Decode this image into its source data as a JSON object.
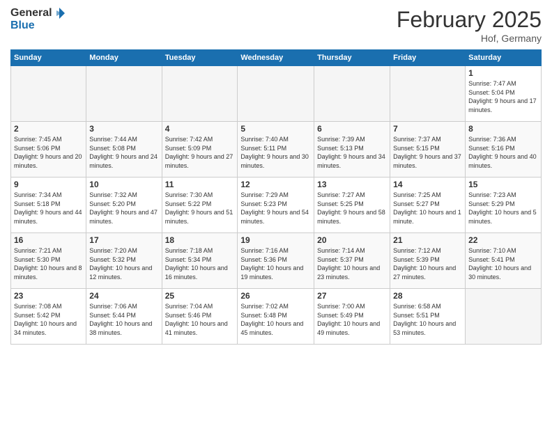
{
  "header": {
    "logo_general": "General",
    "logo_blue": "Blue",
    "month_year": "February 2025",
    "location": "Hof, Germany"
  },
  "weekdays": [
    "Sunday",
    "Monday",
    "Tuesday",
    "Wednesday",
    "Thursday",
    "Friday",
    "Saturday"
  ],
  "weeks": [
    [
      {
        "day": "",
        "empty": true
      },
      {
        "day": "",
        "empty": true
      },
      {
        "day": "",
        "empty": true
      },
      {
        "day": "",
        "empty": true
      },
      {
        "day": "",
        "empty": true
      },
      {
        "day": "",
        "empty": true
      },
      {
        "day": "1",
        "detail": "Sunrise: 7:47 AM\nSunset: 5:04 PM\nDaylight: 9 hours and 17 minutes."
      }
    ],
    [
      {
        "day": "2",
        "detail": "Sunrise: 7:45 AM\nSunset: 5:06 PM\nDaylight: 9 hours and 20 minutes."
      },
      {
        "day": "3",
        "detail": "Sunrise: 7:44 AM\nSunset: 5:08 PM\nDaylight: 9 hours and 24 minutes."
      },
      {
        "day": "4",
        "detail": "Sunrise: 7:42 AM\nSunset: 5:09 PM\nDaylight: 9 hours and 27 minutes."
      },
      {
        "day": "5",
        "detail": "Sunrise: 7:40 AM\nSunset: 5:11 PM\nDaylight: 9 hours and 30 minutes."
      },
      {
        "day": "6",
        "detail": "Sunrise: 7:39 AM\nSunset: 5:13 PM\nDaylight: 9 hours and 34 minutes."
      },
      {
        "day": "7",
        "detail": "Sunrise: 7:37 AM\nSunset: 5:15 PM\nDaylight: 9 hours and 37 minutes."
      },
      {
        "day": "8",
        "detail": "Sunrise: 7:36 AM\nSunset: 5:16 PM\nDaylight: 9 hours and 40 minutes."
      }
    ],
    [
      {
        "day": "9",
        "detail": "Sunrise: 7:34 AM\nSunset: 5:18 PM\nDaylight: 9 hours and 44 minutes."
      },
      {
        "day": "10",
        "detail": "Sunrise: 7:32 AM\nSunset: 5:20 PM\nDaylight: 9 hours and 47 minutes."
      },
      {
        "day": "11",
        "detail": "Sunrise: 7:30 AM\nSunset: 5:22 PM\nDaylight: 9 hours and 51 minutes."
      },
      {
        "day": "12",
        "detail": "Sunrise: 7:29 AM\nSunset: 5:23 PM\nDaylight: 9 hours and 54 minutes."
      },
      {
        "day": "13",
        "detail": "Sunrise: 7:27 AM\nSunset: 5:25 PM\nDaylight: 9 hours and 58 minutes."
      },
      {
        "day": "14",
        "detail": "Sunrise: 7:25 AM\nSunset: 5:27 PM\nDaylight: 10 hours and 1 minute."
      },
      {
        "day": "15",
        "detail": "Sunrise: 7:23 AM\nSunset: 5:29 PM\nDaylight: 10 hours and 5 minutes."
      }
    ],
    [
      {
        "day": "16",
        "detail": "Sunrise: 7:21 AM\nSunset: 5:30 PM\nDaylight: 10 hours and 8 minutes."
      },
      {
        "day": "17",
        "detail": "Sunrise: 7:20 AM\nSunset: 5:32 PM\nDaylight: 10 hours and 12 minutes."
      },
      {
        "day": "18",
        "detail": "Sunrise: 7:18 AM\nSunset: 5:34 PM\nDaylight: 10 hours and 16 minutes."
      },
      {
        "day": "19",
        "detail": "Sunrise: 7:16 AM\nSunset: 5:36 PM\nDaylight: 10 hours and 19 minutes."
      },
      {
        "day": "20",
        "detail": "Sunrise: 7:14 AM\nSunset: 5:37 PM\nDaylight: 10 hours and 23 minutes."
      },
      {
        "day": "21",
        "detail": "Sunrise: 7:12 AM\nSunset: 5:39 PM\nDaylight: 10 hours and 27 minutes."
      },
      {
        "day": "22",
        "detail": "Sunrise: 7:10 AM\nSunset: 5:41 PM\nDaylight: 10 hours and 30 minutes."
      }
    ],
    [
      {
        "day": "23",
        "detail": "Sunrise: 7:08 AM\nSunset: 5:42 PM\nDaylight: 10 hours and 34 minutes."
      },
      {
        "day": "24",
        "detail": "Sunrise: 7:06 AM\nSunset: 5:44 PM\nDaylight: 10 hours and 38 minutes."
      },
      {
        "day": "25",
        "detail": "Sunrise: 7:04 AM\nSunset: 5:46 PM\nDaylight: 10 hours and 41 minutes."
      },
      {
        "day": "26",
        "detail": "Sunrise: 7:02 AM\nSunset: 5:48 PM\nDaylight: 10 hours and 45 minutes."
      },
      {
        "day": "27",
        "detail": "Sunrise: 7:00 AM\nSunset: 5:49 PM\nDaylight: 10 hours and 49 minutes."
      },
      {
        "day": "28",
        "detail": "Sunrise: 6:58 AM\nSunset: 5:51 PM\nDaylight: 10 hours and 53 minutes."
      },
      {
        "day": "",
        "empty": true
      }
    ]
  ]
}
